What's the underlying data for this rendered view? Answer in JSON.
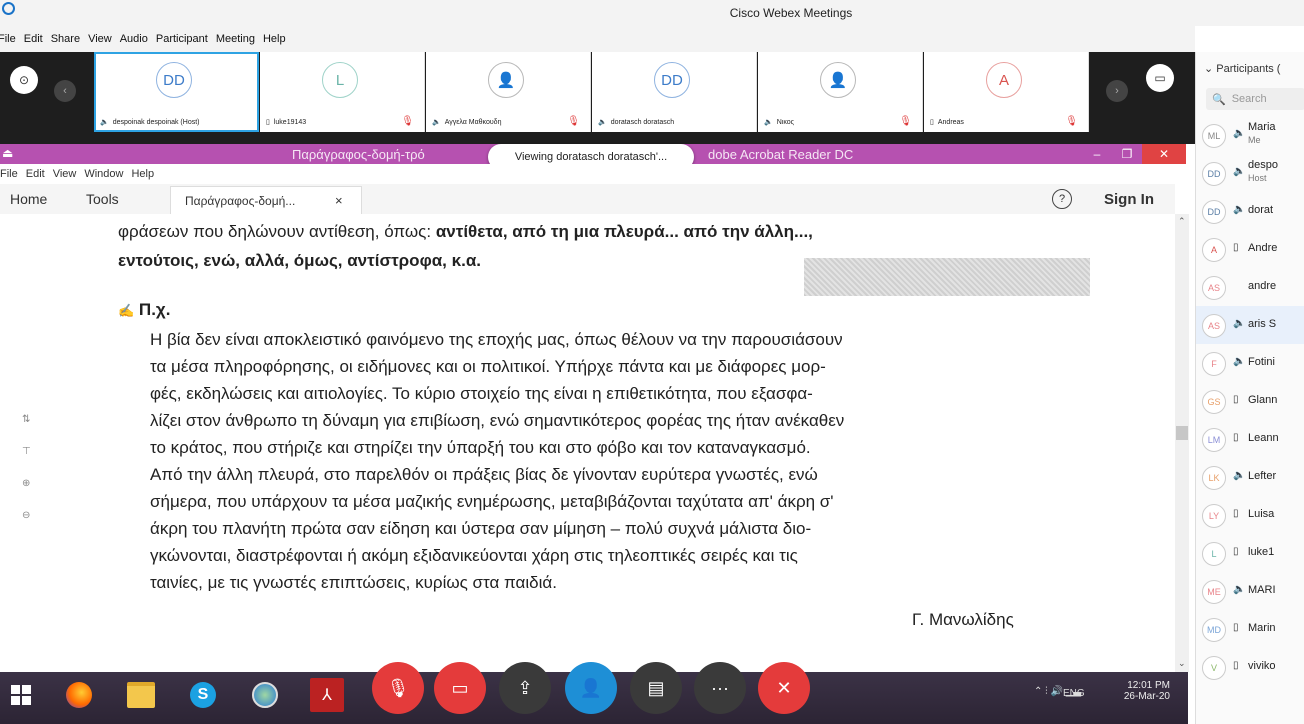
{
  "webex": {
    "title": "Cisco Webex Meetings",
    "menu": [
      "File",
      "Edit",
      "Share",
      "View",
      "Audio",
      "Participant",
      "Meeting",
      "Help"
    ],
    "tiles": [
      {
        "initials": "DD",
        "name": "despoinak despoinak (Host)",
        "muted": false
      },
      {
        "initials": "L",
        "name": "luke19143",
        "muted": true
      },
      {
        "initials": "",
        "name": "Αγγελα Μαθκουδη",
        "muted": true
      },
      {
        "initials": "DD",
        "name": "doratasch doratasch",
        "muted": false
      },
      {
        "initials": "",
        "name": "Νικος",
        "muted": true
      },
      {
        "initials": "A",
        "name": "Andreas",
        "muted": true
      }
    ]
  },
  "viewing_badge": "Viewing doratasch doratasch'...",
  "acrobat": {
    "title_left": "Παράγραφος-δομή-τρό",
    "title_right": "dobe Acrobat Reader DC",
    "menu": [
      "File",
      "Edit",
      "View",
      "Window",
      "Help"
    ],
    "tabs": {
      "home": "Home",
      "tools": "Tools",
      "doc": "Παράγραφος-δομή...",
      "close": "×"
    },
    "help_icon": "?",
    "signin": "Sign In",
    "doc": {
      "line1_plain": "φράσεων που δηλώνουν αντίθεση, όπως: ",
      "line1_bold": "αντίθετα, από τη μια πλευρά... από την άλλη...,",
      "line2_bold": "εντούτοις, ενώ, αλλά, όμως, αντίστροφα, κ.α.",
      "example_label": "Π.χ.",
      "paragraph": [
        "Η βία δεν είναι αποκλειστικό φαινόμενο της εποχής μας, όπως θέλουν να την παρουσιάσουν",
        "τα μέσα πληροφόρησης, οι ειδήμονες και οι πολιτικοί. Υπήρχε πάντα και με διάφορες μορ-",
        "φές, εκδηλώσεις και αιτιολογίες. Το κύριο στοιχείο της είναι η επιθετικότητα, που εξασφα-",
        "λίζει στον άνθρωπο τη δύναμη για επιβίωση, ενώ σημαντικότερος φορέας της ήταν ανέκαθεν",
        "το κράτος, που στήριζε και στηρίζει την ύπαρξή του και στο φόβο και τον καταναγκασμό.",
        "Από την άλλη πλευρά, στο παρελθόν οι πράξεις βίας δε γίνονταν ευρύτερα γνωστές, ενώ",
        "σήμερα, που υπάρχουν τα μέσα μαζικής ενημέρωσης, μεταβιβάζονται ταχύτατα απ' άκρη σ'",
        "άκρη του πλανήτη πρώτα σαν είδηση και ύστερα σαν μίμηση – πολύ συχνά μάλιστα διο-",
        "γκώνονται, διαστρέφονται ή ακόμη εξιδανικεύονται χάρη στις τηλεοπτικές σειρές και τις",
        "ταινίες, με τις γνωστές επιπτώσεις, κυρίως στα παιδιά."
      ],
      "author": "Γ. Μανωλίδης"
    }
  },
  "taskbar": {
    "lang": "ENG",
    "time": "12:01 PM",
    "date": "26-Mar-20"
  },
  "participants": {
    "header": "Participants (",
    "search_placeholder": "Search",
    "rows": [
      {
        "initials": "ML",
        "name": "Maria",
        "sub": "Me",
        "device": "phone",
        "color": "#888"
      },
      {
        "initials": "DD",
        "name": "despo",
        "sub": "Host",
        "device": "phone",
        "color": "#5b7fa6"
      },
      {
        "initials": "DD",
        "name": "dorat",
        "sub": "",
        "device": "phone",
        "color": "#5b7fa6"
      },
      {
        "initials": "A",
        "name": "Andre",
        "sub": "",
        "device": "tablet",
        "color": "#d9534f"
      },
      {
        "initials": "AS",
        "name": "andre",
        "sub": "",
        "device": "none",
        "color": "#e8848a"
      },
      {
        "initials": "AS",
        "name": "aris S",
        "sub": "",
        "device": "phone",
        "color": "#e8848a"
      },
      {
        "initials": "F",
        "name": "Fotini",
        "sub": "",
        "device": "phone",
        "color": "#e8848a"
      },
      {
        "initials": "GS",
        "name": "Glann",
        "sub": "",
        "device": "tablet",
        "color": "#e8a06a"
      },
      {
        "initials": "LM",
        "name": "Leann",
        "sub": "",
        "device": "tablet",
        "color": "#8b8fd6"
      },
      {
        "initials": "LK",
        "name": "Lefter",
        "sub": "",
        "device": "phone",
        "color": "#e8a06a"
      },
      {
        "initials": "LY",
        "name": "Luisa",
        "sub": "",
        "device": "tablet",
        "color": "#e8848a"
      },
      {
        "initials": "L",
        "name": "luke1",
        "sub": "",
        "device": "tablet",
        "color": "#6ab4a8"
      },
      {
        "initials": "ME",
        "name": "MARI",
        "sub": "",
        "device": "phone",
        "color": "#e8848a"
      },
      {
        "initials": "MD",
        "name": "Marin",
        "sub": "",
        "device": "tablet",
        "color": "#7aa5d8"
      },
      {
        "initials": "V",
        "name": "viviko",
        "sub": "",
        "device": "tablet",
        "color": "#8bb86a"
      }
    ]
  }
}
